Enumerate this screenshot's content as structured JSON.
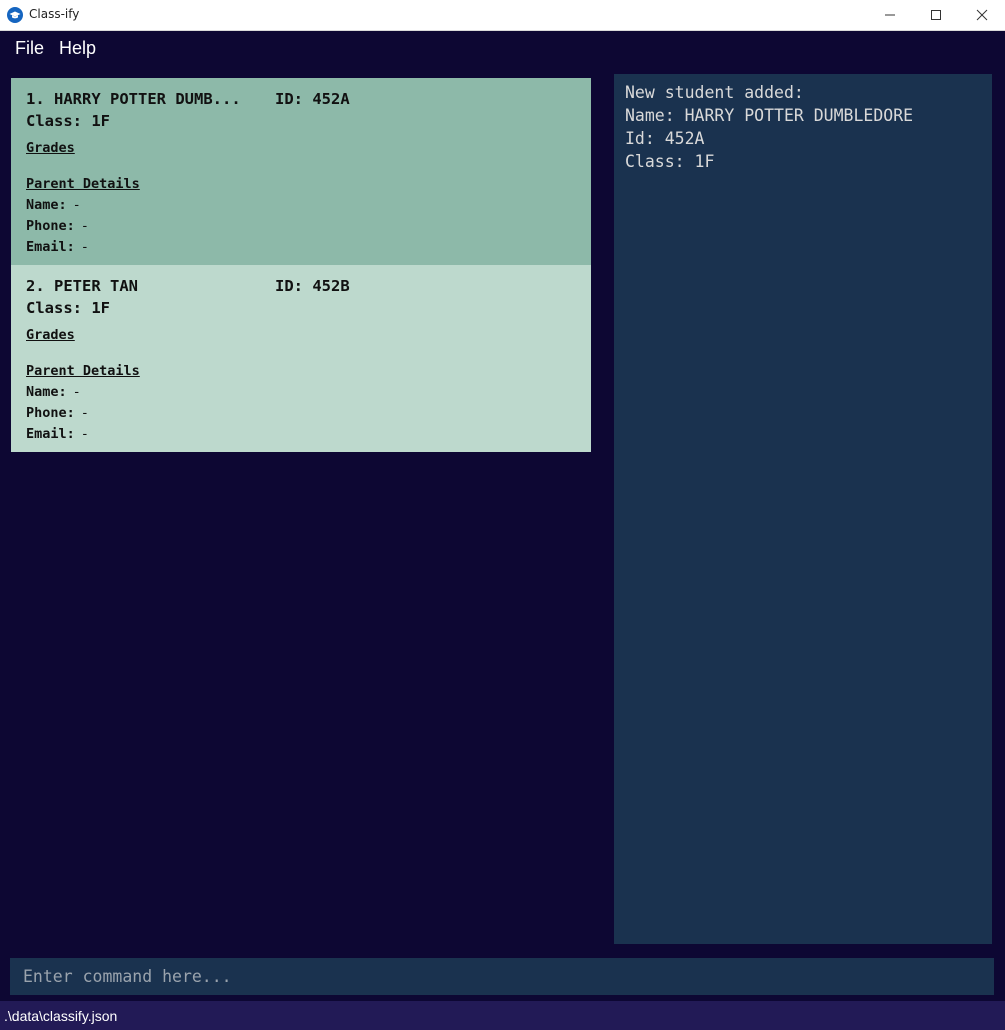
{
  "window": {
    "title": "Class-ify",
    "minimize_icon": "minimize-icon",
    "maximize_icon": "maximize-icon",
    "close_icon": "close-icon"
  },
  "menu": {
    "file": "File",
    "help": "Help"
  },
  "students": [
    {
      "index": "1.",
      "name": "HARRY POTTER DUMB...",
      "id_label": "ID:",
      "id": "452A",
      "class_label": "Class:",
      "class": "1F",
      "grades_label": "Grades",
      "parent_details_label": "Parent Details",
      "parent_name_label": "Name:",
      "parent_name": "-",
      "parent_phone_label": "Phone:",
      "parent_phone": "-",
      "parent_email_label": "Email:",
      "parent_email": "-"
    },
    {
      "index": "2.",
      "name": "PETER TAN",
      "id_label": "ID:",
      "id": "452B",
      "class_label": "Class:",
      "class": "1F",
      "grades_label": "Grades",
      "parent_details_label": "Parent Details",
      "parent_name_label": "Name:",
      "parent_name": "-",
      "parent_phone_label": "Phone:",
      "parent_phone": "-",
      "parent_email_label": "Email:",
      "parent_email": "-"
    }
  ],
  "result": {
    "lines": [
      "New student added:",
      "Name: HARRY POTTER DUMBLEDORE",
      "Id: 452A",
      "Class: 1F"
    ]
  },
  "command": {
    "value": "",
    "placeholder": "Enter command here..."
  },
  "status": {
    "path": ".\\data\\classify.json"
  },
  "colors": {
    "background": "#0d0733",
    "selected_card": "#8db9a9",
    "card": "#bdd9cd",
    "panel": "#1a324f",
    "statusbar": "#221a56",
    "app_icon": "#1565c0"
  }
}
